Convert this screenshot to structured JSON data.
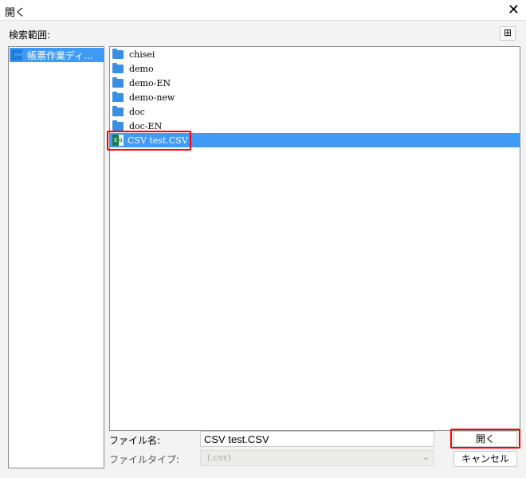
{
  "window": {
    "title": "開く",
    "close": "✕"
  },
  "lookin_label": "検索範囲:",
  "new_folder_icon": "new-folder-icon",
  "left_panel": {
    "items": [
      {
        "label": "帳票作業ディ..."
      }
    ]
  },
  "files": [
    {
      "name": "chisei",
      "type": "folder"
    },
    {
      "name": "demo",
      "type": "folder"
    },
    {
      "name": "demo-EN",
      "type": "folder"
    },
    {
      "name": "demo-new",
      "type": "folder"
    },
    {
      "name": "doc",
      "type": "folder"
    },
    {
      "name": "doc-EN",
      "type": "folder"
    },
    {
      "name": "CSV test.CSV",
      "type": "csv",
      "selected": true
    }
  ],
  "filename": {
    "label": "ファイル名:",
    "value": "CSV test.CSV"
  },
  "filetype": {
    "label": "ファイルタイプ:",
    "value": "(.csv)"
  },
  "buttons": {
    "open": "開く",
    "cancel": "キャンセル"
  },
  "colors": {
    "selection": "#3f9bf5",
    "highlight": "#ff0000"
  }
}
